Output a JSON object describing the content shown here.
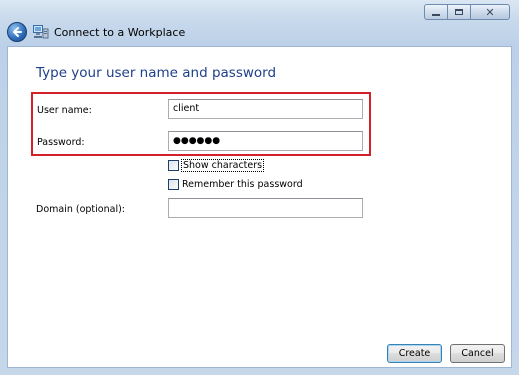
{
  "window": {
    "title": "Connect to a Workplace",
    "controls": {
      "minimize": "minimize-icon",
      "maximize": "maximize-icon",
      "close": "close-icon"
    }
  },
  "main": {
    "heading": "Type your user name and password",
    "username": {
      "label": "User name:",
      "value": "client"
    },
    "password": {
      "label": "Password:",
      "value": "●●●●●●"
    },
    "show_characters": {
      "label": "Show characters",
      "checked": false
    },
    "remember_password": {
      "label": "Remember this password",
      "checked": false
    },
    "domain": {
      "label": "Domain (optional):",
      "value": ""
    }
  },
  "footer": {
    "create_label": "Create",
    "cancel_label": "Cancel"
  },
  "colors": {
    "heading": "#1e3f8a",
    "highlight": "#d4202a"
  }
}
